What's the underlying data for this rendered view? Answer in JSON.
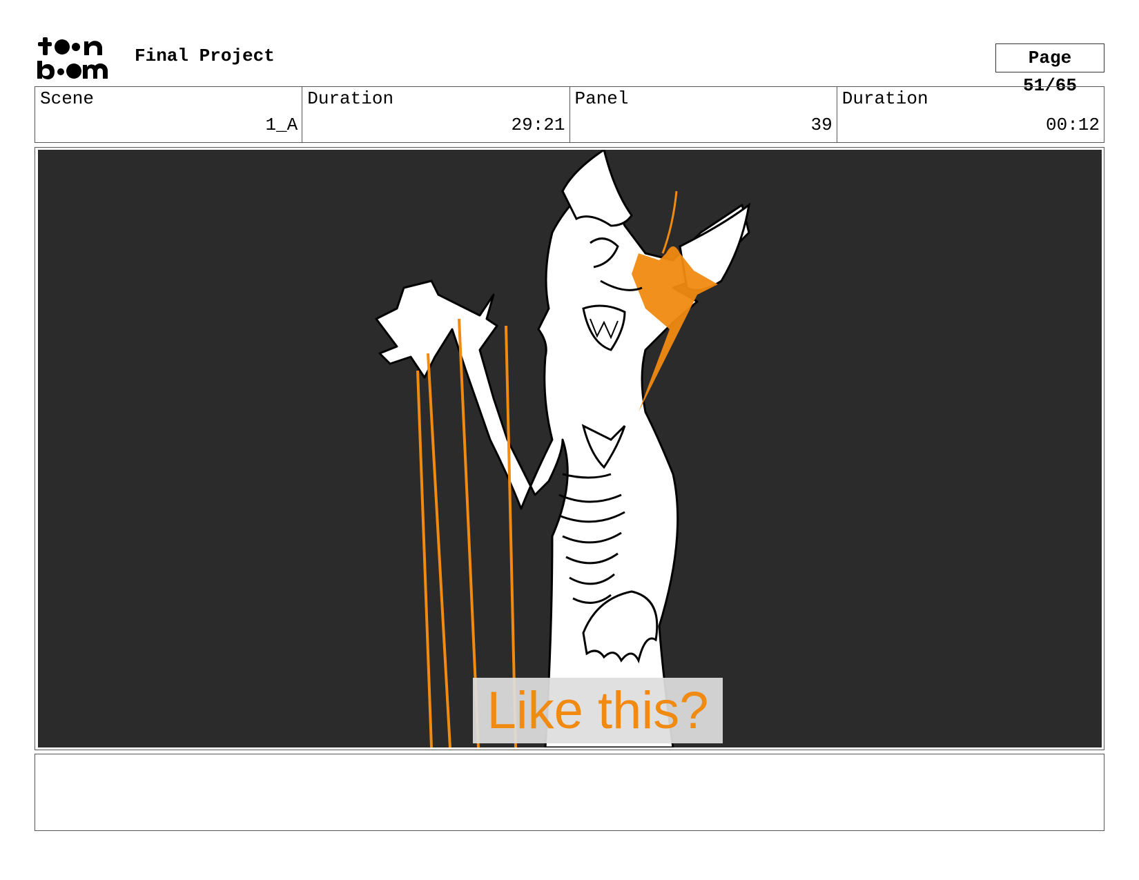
{
  "header": {
    "logo_text_top": "toon",
    "logo_text_bottom": "boom",
    "project_title": "Final Project",
    "page_label": "Page 51/65"
  },
  "info": [
    {
      "label": "Scene",
      "value": "1_A"
    },
    {
      "label": "Duration",
      "value": "29:21"
    },
    {
      "label": "Panel",
      "value": "39"
    },
    {
      "label": "Duration",
      "value": "00:12"
    }
  ],
  "panel": {
    "caption": "Like this?",
    "accent_color": "#f08a10",
    "background_color": "#2b2b2b"
  },
  "notes": {
    "text": ""
  }
}
